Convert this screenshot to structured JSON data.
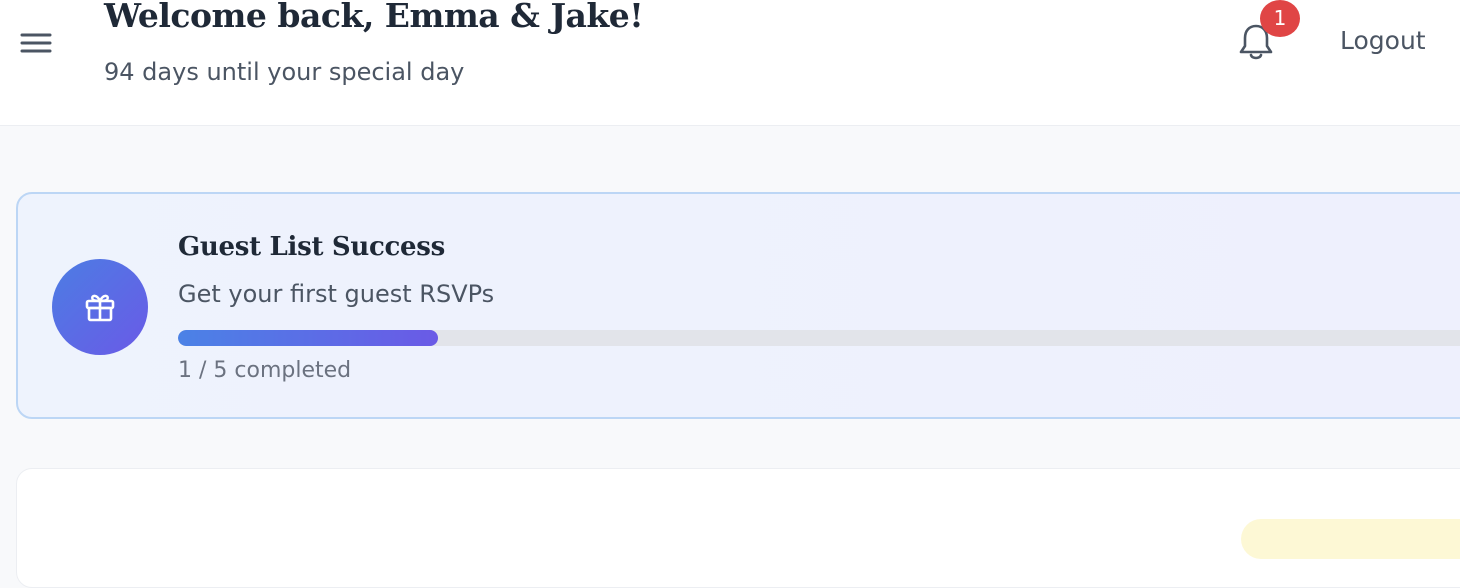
{
  "header": {
    "title": "Welcome back, Emma & Jake!",
    "subtitle": "94 days until your special day",
    "notification_count": "1",
    "logout_label": "Logout",
    "icons": {
      "menu": "menu-icon",
      "notifications": "bell-icon"
    }
  },
  "achievement": {
    "icon": "gift-icon",
    "title": "Guest List Success",
    "description": "Get your first guest RSVPs",
    "completed": 1,
    "total": 5,
    "progress_text": "1 / 5 completed"
  },
  "colors": {
    "badge": "#e04545",
    "accent_start": "#4b82e6",
    "accent_end": "#6a5ae6"
  }
}
